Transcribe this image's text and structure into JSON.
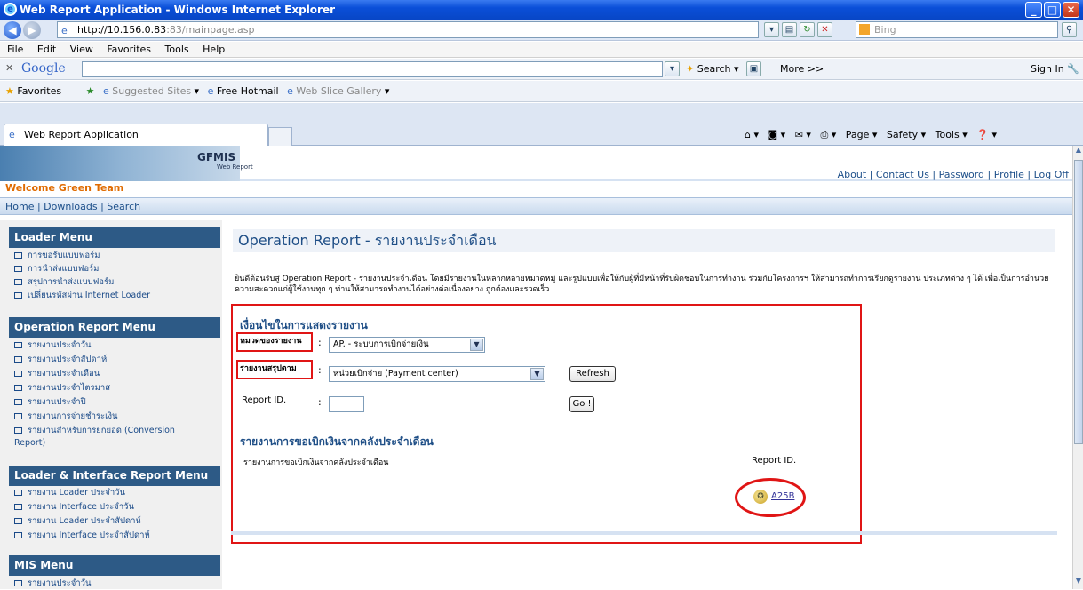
{
  "window": {
    "title": "Web Report Application - Windows Internet Explorer"
  },
  "browser": {
    "address_host": "http://10.156.0.83",
    "address_rest": ":83/mainpage.asp",
    "search_placeholder": "Bing",
    "menu": [
      "File",
      "Edit",
      "View",
      "Favorites",
      "Tools",
      "Help"
    ],
    "google_label": "Google",
    "google_search": "Search",
    "google_more": "More >>",
    "sign_in": "Sign In",
    "favorites_label": "Favorites",
    "fav_links": [
      "Suggested Sites",
      "Free Hotmail",
      "Web Slice Gallery"
    ],
    "tab_title": "Web Report Application",
    "cmd": [
      "Page",
      "Safety",
      "Tools"
    ]
  },
  "site": {
    "logo_title": "GFMIS",
    "logo_sub": "Web Report",
    "top_links": "About | Contact Us | Password | Profile | Log Off",
    "welcome": "Welcome Green Team",
    "nav": "Home | Downloads | Search"
  },
  "sidebar": {
    "loader": {
      "title": "Loader Menu",
      "items": [
        "การขอรับแบบฟอร์ม",
        "การนำส่งแบบฟอร์ม",
        "สรุปการนำส่งแบบฟอร์ม",
        "เปลี่ยนรหัสผ่าน Internet Loader"
      ]
    },
    "operation": {
      "title": "Operation Report Menu",
      "items": [
        "รายงานประจำวัน",
        "รายงานประจำสัปดาห์",
        "รายงานประจำเดือน",
        "รายงานประจำไตรมาส",
        "รายงานประจำปี",
        "รายงานการจ่ายชำระเงิน",
        "รายงานสำหรับการยกยอด (Conversion Report)"
      ]
    },
    "interface": {
      "title": "Loader & Interface Report Menu",
      "items": [
        "รายงาน Loader ประจำวัน",
        "รายงาน Interface ประจำวัน",
        "รายงาน Loader ประจำสัปดาห์",
        "รายงาน Interface ประจำสัปดาห์"
      ]
    },
    "mis": {
      "title": "MIS Menu",
      "items": [
        "รายงานประจำวัน"
      ]
    }
  },
  "main": {
    "title": "Operation Report -  รายงานประจำเดือน",
    "intro": "ยินดีต้อนรับสู่ Operation Report - รายงานประจำเดือน  โดยมีรายงานในหลากหลายหมวดหมู่ และรูปแบบเพื่อให้กับผู้ที่มีหน้าที่รับผิดชอบในการทำงาน ร่วมกับโครงการฯ ให้สามารถทำการเรียกดูรายงาน ประเภทต่าง ๆ ได้ เพื่อเป็นการอำนวยความสะดวกแก่ผู้ใช้งานทุก ๆ ท่านให้สามารถทำงานได้อย่างต่อเนื่องอย่าง ถูกต้องและรวดเร็ว",
    "cond_title": "เงื่อนไขในการแสดงรายงาน",
    "category_label": "หมวดของรายงาน",
    "category_value": "AP. - ระบบการเบิกจ่ายเงิน",
    "summary_label": "รายงานสรุปตาม",
    "summary_value": "หน่วยเบิกจ่าย (Payment center)",
    "refresh": "Refresh",
    "report_id_label": "Report ID.",
    "go": "Go !",
    "section_title": "รายงานการขอเบิกเงินจากคลังประจำเดือน",
    "row_label": "รายงานการขอเบิกเงินจากคลังประจำเดือน",
    "col_report_id": "Report ID.",
    "report_link": "A25B"
  }
}
